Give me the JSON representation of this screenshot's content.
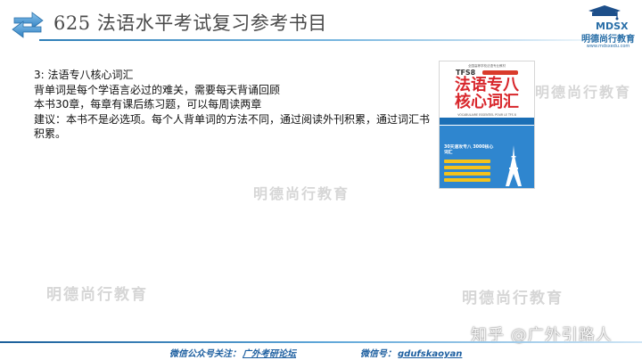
{
  "header": {
    "title": "625  法语水平考试复习参考书目"
  },
  "logo": {
    "mark": "MDSX",
    "name": "明德尚行教育",
    "url": "www.mdsxedu.com"
  },
  "content": {
    "lines": [
      "3: 法语专八核心词汇",
      "背单词是每个学语言必过的难关，需要每天背诵回顾",
      "本书30章，每章有课后练习题，可以每周读两章",
      "建议：本书不是必选项。每个人背单词的方法不同，通过阅读外刊积累，通过词汇书积累。"
    ]
  },
  "book": {
    "publisher": "全国高等学校法语专业教材",
    "series": "TFS8",
    "title_line1": "法语专八",
    "title_line2": "核心词汇",
    "subtitle": "VOCABULAIRE ESSENTIEL POUR LE TFS 8",
    "blurb": "30天速攻专八 3000核心词汇"
  },
  "watermarks": {
    "brand": "明德尚行教育",
    "zhihu": "知乎 @广外引路人"
  },
  "footer": {
    "wechat_public_label": "微信公众号关注：",
    "wechat_public_value": "广外考研论坛",
    "wechat_id_label": "微信号：",
    "wechat_id_value": "gdufskaoyan"
  },
  "colors": {
    "accent_blue": "#2f7fb8",
    "book_red": "#d8262b",
    "book_blue": "#2f86cf",
    "footer_text": "#1d5fa0"
  }
}
